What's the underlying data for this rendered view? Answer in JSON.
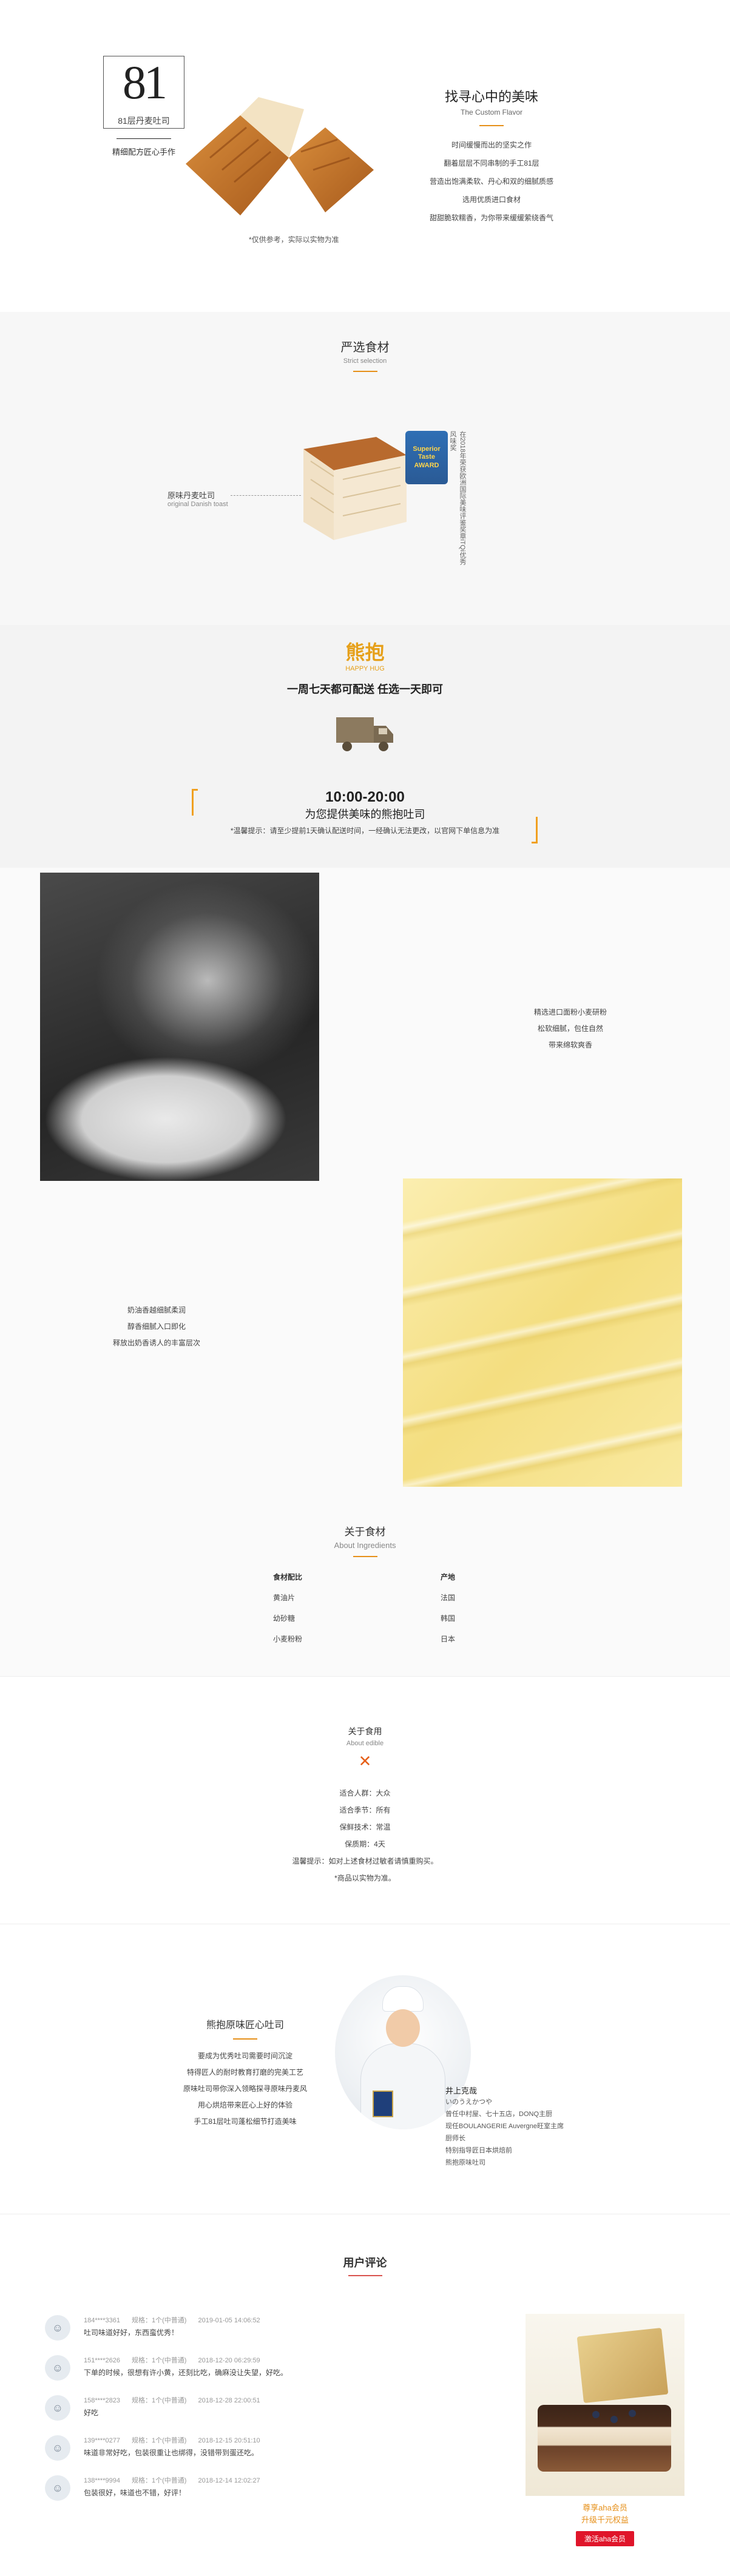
{
  "hero": {
    "logo_number": "81",
    "logo_sub": "81层丹麦吐司",
    "tagline": "精细配方匠心手作",
    "title": "找寻心中的美味",
    "title_en": "The Custom Flavor",
    "lines": [
      "时间缓慢而出的坚实之作",
      "翻着层层不同串制的手工81层",
      "营造出饱满柔软、丹心和双的细腻质感",
      "选用优质进口食材",
      "甜甜脆软糯香，为你带来缓缓萦绕香气"
    ],
    "note": "*仅供参考，实际以实物为准"
  },
  "strict": {
    "title": "严选食材",
    "title_en": "Strict selection",
    "label_cn": "原味丹麦吐司",
    "label_en": "original Danish toast",
    "badge": "Superior Taste AWARD",
    "vertical_text": "在2018年荣获欧洲国际美味评鉴奖章iTQi优秀风味奖"
  },
  "delivery": {
    "brand": "熊抱",
    "brand_en": "HAPPY HUG",
    "headline": "一周七天都可配送 任选一天即可",
    "time": "10:00-20:00",
    "time_sub": "为您提供美味的熊抱吐司",
    "tip": "*温馨提示：请至少提前1天确认配送时间，一经确认无法更改，以官网下单信息为准"
  },
  "flour": {
    "lines": [
      "精选进口面粉小麦研粉",
      "松软细腻，包住自然",
      "带来绵软爽香"
    ]
  },
  "butter": {
    "lines": [
      "奶油香越细腻柔润",
      "醇香细腻入口即化",
      "释放出奶香诱人的丰富层次"
    ]
  },
  "about_ingredients": {
    "title": "关于食材",
    "title_en": "About Ingredients",
    "headers": [
      "食材配比",
      "产地"
    ],
    "rows": [
      [
        "黄油片",
        "法国"
      ],
      [
        "幼砂糖",
        "韩国"
      ],
      [
        "小麦粉粉",
        "日本"
      ]
    ]
  },
  "edible": {
    "title": "关于食用",
    "title_en": "About edible",
    "lines": [
      "适合人群：大众",
      "适合季节：所有",
      "保鲜技术：常温",
      "保质期：4天",
      "温馨提示：如对上述食材过敏者请慎重购买。",
      "*商品以实物为准。"
    ]
  },
  "chef": {
    "title": "熊抱原味匠心吐司",
    "lines": [
      "要成为优秀吐司需要时间沉淀",
      "特得匠人的耐时教育打磨的完美工艺",
      "原味吐司带你深入领略探寻原味丹麦风",
      "用心烘焙带来匠心上好的体验",
      "手工81层吐司蓬松细节打造美味"
    ],
    "name": "井上克哉",
    "name_jp": "いのうえかつや",
    "info": [
      "曾任中村屋、七十五店，DONQ主厨",
      "现任BOULANGERIE Auvergne旺室主席厨师长",
      "特别指导匠日本烘焙前",
      "熊抱原味吐司"
    ]
  },
  "reviews": {
    "title": "用户评论",
    "items": [
      {
        "user": "184****3361",
        "spec": "规格：1个(中普通)",
        "date": "2019-01-05 14:06:52",
        "text": "吐司味道好好，东西蛮优秀！"
      },
      {
        "user": "151****2626",
        "spec": "规格：1个(中普通)",
        "date": "2018-12-20 06:29:59",
        "text": "下单的时候，很想有许小黄，还刻比吃，确麻没让失望，好吃。"
      },
      {
        "user": "158****2823",
        "spec": "规格：1个(中普通)",
        "date": "2018-12-28 22:00:51",
        "text": "好吃"
      },
      {
        "user": "139****0277",
        "spec": "规格：1个(中普通)",
        "date": "2018-12-15 20:51:10",
        "text": "味道非常好吃，包装很重让也绑得，没错带到蛋还吃。"
      },
      {
        "user": "138****9994",
        "spec": "规格：1个(中普通)",
        "date": "2018-12-14 12:02:27",
        "text": "包装很好，味道也不错，好评！"
      }
    ]
  },
  "promo": {
    "line1": "尊享aha会员",
    "line2": "升级千元权益",
    "button": "激活aha会员"
  },
  "colors": {
    "accent": "#e6901a",
    "brand": "#e6a01a",
    "button": "#e0152a"
  }
}
